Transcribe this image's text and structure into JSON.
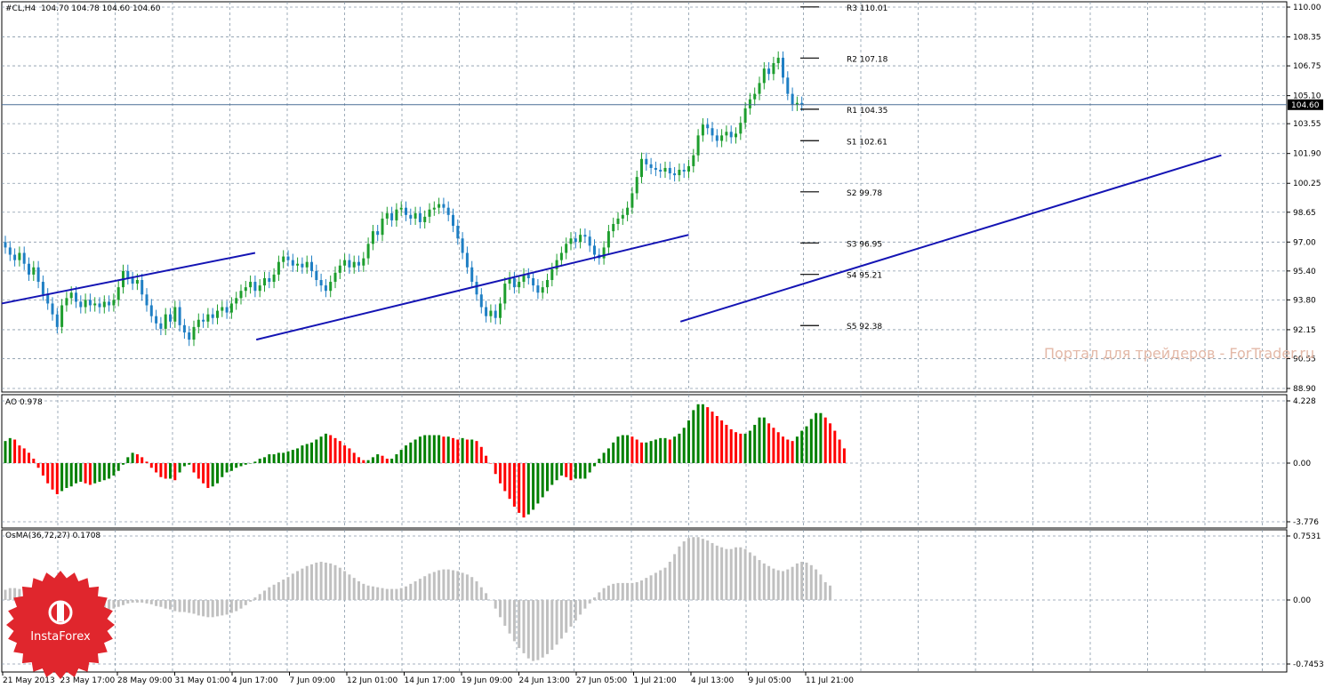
{
  "chart_data": [
    {
      "type": "candlestick",
      "symbol_label": "#CL,H4",
      "ohlc_label": "104.70 104.78 104.60 104.60",
      "current_price": "104.60",
      "price_ticks": [
        "110.00",
        "108.35",
        "106.75",
        "105.10",
        "103.55",
        "101.90",
        "100.25",
        "98.65",
        "97.00",
        "95.40",
        "93.80",
        "92.15",
        "90.55",
        "88.90"
      ],
      "ylim": [
        88.9,
        110.0
      ],
      "x_labels": [
        "21 May 2013",
        "23 May 17:00",
        "28 May 09:00",
        "31 May 01:00",
        "4 Jun 17:00",
        "7 Jun 09:00",
        "12 Jun 01:00",
        "14 Jun 17:00",
        "19 Jun 09:00",
        "24 Jun 13:00",
        "27 Jun 05:00",
        "1 Jul 21:00",
        "4 Jul 13:00",
        "9 Jul 05:00",
        "11 Jul 21:00"
      ],
      "close": [
        96.7,
        96.3,
        96.0,
        96.4,
        95.8,
        95.2,
        95.6,
        94.8,
        94.1,
        93.6,
        93.0,
        92.3,
        93.5,
        93.9,
        94.2,
        93.7,
        93.4,
        93.8,
        93.5,
        93.6,
        93.4,
        93.7,
        93.5,
        93.8,
        94.5,
        95.4,
        95.0,
        94.7,
        94.9,
        94.1,
        93.5,
        92.9,
        92.5,
        92.2,
        93.0,
        92.6,
        93.4,
        92.4,
        92.0,
        91.6,
        92.3,
        92.7,
        92.6,
        93.0,
        92.8,
        93.2,
        93.4,
        93.1,
        93.6,
        93.9,
        94.3,
        94.5,
        94.8,
        94.3,
        94.6,
        95.0,
        94.8,
        95.2,
        95.9,
        96.2,
        96.0,
        95.7,
        95.8,
        95.6,
        95.9,
        95.4,
        94.9,
        94.6,
        94.3,
        94.8,
        95.3,
        95.7,
        96.0,
        95.6,
        95.9,
        95.7,
        96.1,
        96.9,
        97.6,
        97.4,
        98.3,
        98.6,
        98.2,
        98.8,
        98.9,
        98.5,
        98.3,
        98.6,
        98.1,
        98.4,
        98.8,
        98.9,
        99.1,
        98.9,
        98.5,
        97.9,
        97.2,
        96.4,
        95.6,
        94.8,
        94.1,
        93.4,
        92.9,
        93.2,
        92.8,
        93.6,
        94.7,
        95.0,
        94.5,
        94.8,
        95.2,
        95.0,
        94.6,
        94.2,
        94.5,
        94.9,
        95.5,
        96.0,
        96.4,
        96.9,
        97.2,
        97.0,
        97.4,
        97.3,
        96.8,
        96.3,
        96.1,
        96.7,
        97.6,
        98.0,
        98.3,
        98.5,
        98.9,
        99.7,
        100.6,
        101.6,
        101.3,
        101.1,
        101.0,
        100.9,
        101.1,
        100.8,
        100.7,
        101.0,
        100.9,
        101.2,
        101.8,
        102.9,
        103.5,
        103.3,
        102.9,
        102.6,
        102.9,
        103.1,
        102.8,
        103.0,
        103.6,
        104.4,
        104.9,
        105.2,
        105.8,
        106.6,
        106.3,
        106.9,
        107.2,
        106.1,
        105.2,
        104.6,
        104.7,
        104.6
      ],
      "support_resistance": [
        {
          "label": "R3 110.01",
          "value": 110.01
        },
        {
          "label": "R2 107.18",
          "value": 107.18
        },
        {
          "label": "R1 104.35",
          "value": 104.35
        },
        {
          "label": "S1 102.61",
          "value": 102.61
        },
        {
          "label": "S2 99.78",
          "value": 99.78
        },
        {
          "label": "S3 96.95",
          "value": 96.95
        },
        {
          "label": "S4 95.21",
          "value": 95.21
        },
        {
          "label": "S5 92.38",
          "value": 92.38
        }
      ],
      "trend_lines": [
        {
          "x1": 0,
          "y1": 93.6,
          "x2": 53,
          "y2": 96.4
        },
        {
          "x1": 54,
          "y1": 91.6,
          "x2": 145,
          "y2": 97.4
        },
        {
          "x1": 144,
          "y1": 92.6,
          "x2": 258,
          "y2": 101.8
        }
      ],
      "colors": {
        "up": "#1e9e2e",
        "down": "#1f7fc4",
        "trend": "#1414b4",
        "grid": "#8899aa",
        "price_line": "#4a6e96"
      }
    },
    {
      "type": "bar",
      "title": "AO 0.978",
      "ticks": [
        "4.228",
        "0.00",
        "-3.776"
      ],
      "ylim": [
        -3.776,
        4.228
      ],
      "values": [
        1.5,
        1.7,
        1.6,
        1.2,
        1.0,
        0.7,
        0.3,
        -0.3,
        -0.8,
        -1.3,
        -1.7,
        -2.0,
        -1.8,
        -1.6,
        -1.5,
        -1.3,
        -1.2,
        -1.3,
        -1.4,
        -1.3,
        -1.2,
        -1.1,
        -1.0,
        -0.8,
        -0.5,
        -0.1,
        0.4,
        0.7,
        0.6,
        0.4,
        0.1,
        -0.3,
        -0.6,
        -0.9,
        -1.0,
        -1.0,
        -1.1,
        -0.6,
        -0.2,
        -0.1,
        -0.6,
        -1.0,
        -1.3,
        -1.6,
        -1.5,
        -1.3,
        -0.9,
        -0.6,
        -0.5,
        -0.3,
        -0.2,
        -0.1,
        0.0,
        0.1,
        0.3,
        0.4,
        0.6,
        0.6,
        0.7,
        0.7,
        0.8,
        0.9,
        1.0,
        1.2,
        1.3,
        1.4,
        1.6,
        1.8,
        2.0,
        1.9,
        1.7,
        1.5,
        1.2,
        1.0,
        0.7,
        0.4,
        0.2,
        0.2,
        0.4,
        0.6,
        0.5,
        0.3,
        0.3,
        0.6,
        0.9,
        1.2,
        1.4,
        1.6,
        1.8,
        1.9,
        1.9,
        1.9,
        1.9,
        1.8,
        1.8,
        1.7,
        1.6,
        1.7,
        1.6,
        1.6,
        1.5,
        1.1,
        0.5,
        0.0,
        -0.7,
        -1.3,
        -1.8,
        -2.3,
        -2.8,
        -3.2,
        -3.5,
        -3.3,
        -3.0,
        -2.6,
        -2.2,
        -1.8,
        -1.4,
        -1.1,
        -0.8,
        -0.9,
        -1.1,
        -1.0,
        -1.0,
        -1.0,
        -0.6,
        -0.2,
        0.3,
        0.7,
        1.0,
        1.4,
        1.8,
        1.9,
        1.9,
        1.8,
        1.6,
        1.4,
        1.4,
        1.5,
        1.6,
        1.7,
        1.7,
        1.6,
        1.8,
        2.0,
        2.4,
        2.9,
        3.6,
        4.0,
        4.0,
        3.8,
        3.5,
        3.2,
        2.9,
        2.6,
        2.3,
        2.1,
        2.0,
        2.0,
        2.2,
        2.6,
        3.1,
        3.1,
        2.7,
        2.4,
        2.1,
        1.8,
        1.6,
        1.5,
        1.8,
        2.2,
        2.5,
        3.0,
        3.4,
        3.4,
        3.1,
        2.7,
        2.2,
        1.6,
        1.0
      ],
      "colors": {
        "up": "#008000",
        "down": "#ff0000"
      }
    },
    {
      "type": "bar",
      "title": "OsMA(36,72,27) 0.1708",
      "ticks": [
        "0.7531",
        "0.00",
        "-0.7453"
      ],
      "ylim": [
        -0.7453,
        0.7531
      ],
      "values": [
        0.12,
        0.14,
        0.14,
        0.13,
        0.1,
        0.07,
        0.04,
        0.01,
        -0.02,
        -0.05,
        -0.08,
        -0.1,
        -0.11,
        -0.12,
        -0.12,
        -0.12,
        -0.13,
        -0.13,
        -0.13,
        -0.13,
        -0.12,
        -0.12,
        -0.11,
        -0.1,
        -0.08,
        -0.06,
        -0.04,
        -0.03,
        -0.03,
        -0.03,
        -0.04,
        -0.05,
        -0.07,
        -0.08,
        -0.1,
        -0.11,
        -0.13,
        -0.14,
        -0.14,
        -0.15,
        -0.16,
        -0.18,
        -0.19,
        -0.2,
        -0.2,
        -0.19,
        -0.18,
        -0.17,
        -0.15,
        -0.13,
        -0.1,
        -0.06,
        -0.02,
        0.03,
        0.07,
        0.11,
        0.15,
        0.18,
        0.21,
        0.24,
        0.27,
        0.31,
        0.34,
        0.37,
        0.4,
        0.42,
        0.44,
        0.45,
        0.44,
        0.43,
        0.41,
        0.38,
        0.34,
        0.3,
        0.26,
        0.22,
        0.19,
        0.17,
        0.16,
        0.15,
        0.14,
        0.13,
        0.13,
        0.13,
        0.14,
        0.16,
        0.19,
        0.22,
        0.25,
        0.28,
        0.31,
        0.33,
        0.35,
        0.36,
        0.36,
        0.35,
        0.34,
        0.32,
        0.3,
        0.27,
        0.22,
        0.15,
        0.08,
        0.0,
        -0.1,
        -0.2,
        -0.3,
        -0.39,
        -0.48,
        -0.56,
        -0.62,
        -0.68,
        -0.71,
        -0.7,
        -0.67,
        -0.63,
        -0.58,
        -0.52,
        -0.45,
        -0.38,
        -0.31,
        -0.24,
        -0.17,
        -0.1,
        -0.04,
        0.03,
        0.09,
        0.14,
        0.17,
        0.19,
        0.2,
        0.2,
        0.2,
        0.2,
        0.21,
        0.23,
        0.26,
        0.29,
        0.32,
        0.35,
        0.38,
        0.45,
        0.54,
        0.63,
        0.69,
        0.73,
        0.74,
        0.74,
        0.72,
        0.7,
        0.67,
        0.64,
        0.62,
        0.6,
        0.6,
        0.62,
        0.62,
        0.6,
        0.56,
        0.52,
        0.47,
        0.43,
        0.4,
        0.37,
        0.35,
        0.34,
        0.36,
        0.39,
        0.43,
        0.45,
        0.44,
        0.41,
        0.36,
        0.3,
        0.21,
        0.17
      ],
      "colors": {
        "bar": "#c0c0c0"
      }
    }
  ],
  "watermark": "Портал для трейдеров - ForTrader.ru",
  "logo_text": "InstaForex"
}
